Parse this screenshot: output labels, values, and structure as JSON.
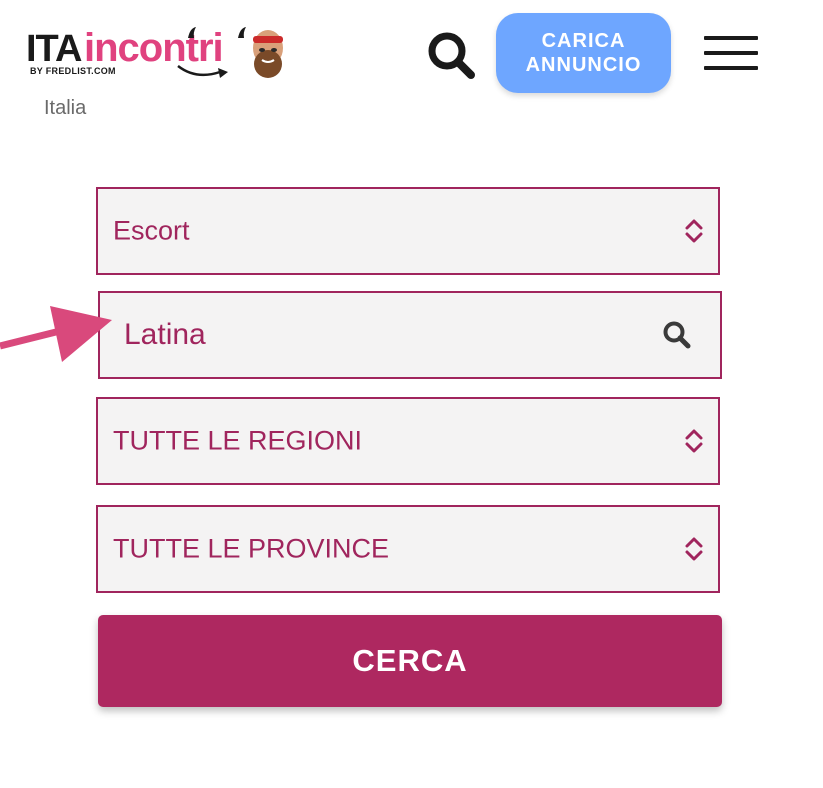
{
  "header": {
    "logo": {
      "brand_left": "ITA",
      "brand_right": "incontri",
      "byline": "BY FREDLIST.COM"
    },
    "upload_button": {
      "line1": "CARICA",
      "line2": "ANNUNCIO"
    },
    "breadcrumb": "Italia"
  },
  "form": {
    "category": "Escort",
    "city": "Latina",
    "region": "TUTTE LE REGIONI",
    "province": "TUTTE LE PROVINCE",
    "submit_label": "CERCA"
  },
  "colors": {
    "accent": "#a0255d",
    "submit": "#ae2860",
    "upload": "#6ea6ff",
    "annotation_arrow": "#d9497c"
  }
}
